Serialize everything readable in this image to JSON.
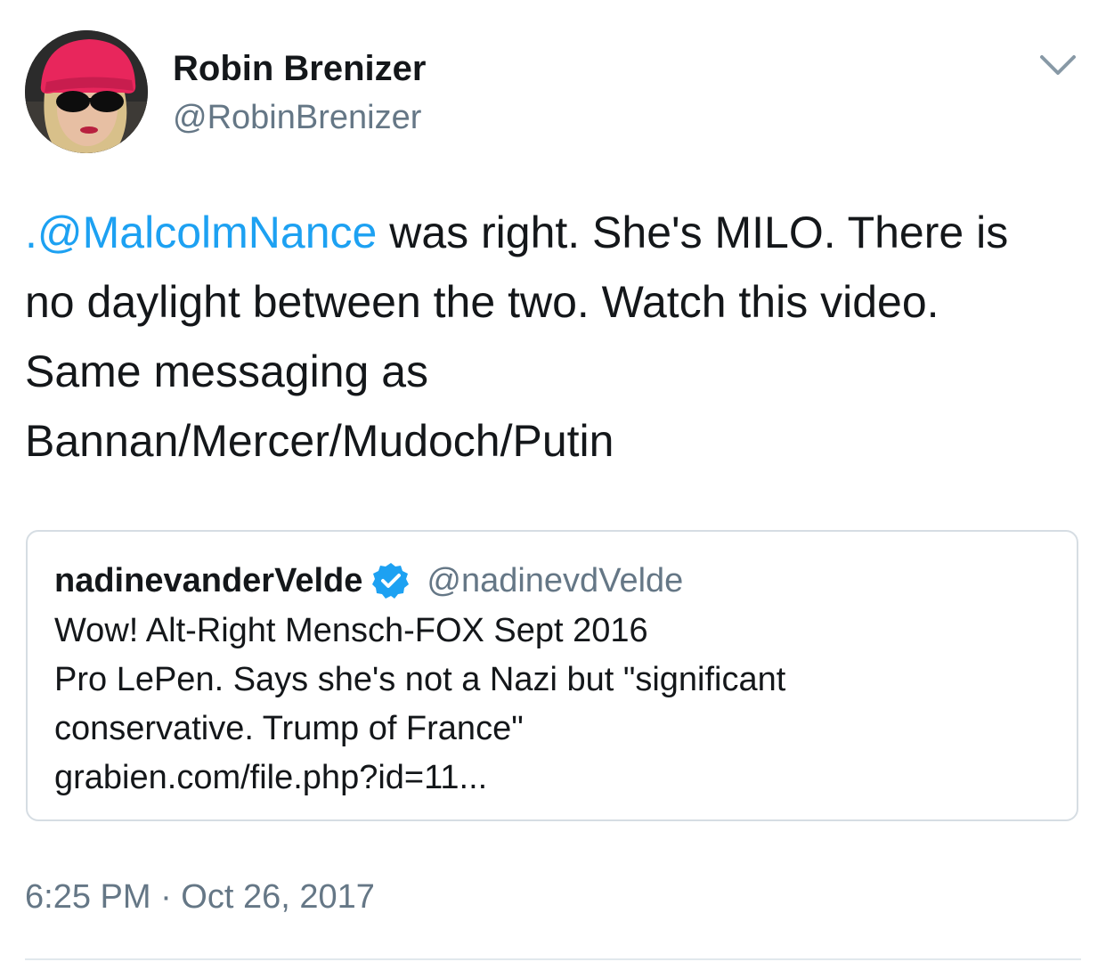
{
  "author": {
    "display_name": "Robin Brenizer",
    "handle": "@RobinBrenizer",
    "avatar_icon": "profile-photo"
  },
  "tweet": {
    "mention": ".@MalcolmNance",
    "line1_rest": " was right. She's MILO. There is",
    "line2": "no daylight between the two. Watch this video.",
    "line3": "Same messaging as",
    "line4": "Bannan/Mercer/Mudoch/Putin",
    "mention_color": "#1da1f2"
  },
  "quoted_tweet": {
    "display_name": "nadinevanderVelde",
    "verified_icon": "verified-badge-icon",
    "verified_color": "#1da1f2",
    "handle": "@nadinevdVelde",
    "lines": [
      "Wow! Alt-Right Mensch-FOX Sept 2016",
      "Pro LePen. Says she's not a Nazi but \"significant",
      "conservative. Trump of France\"",
      "grabien.com/file.php?id=11..."
    ]
  },
  "timestamp": "6:25 PM · Oct 26, 2017",
  "menu_icon": "chevron-down-icon",
  "colors": {
    "text": "#14171a",
    "secondary": "#657786",
    "border": "#d6dde3"
  }
}
